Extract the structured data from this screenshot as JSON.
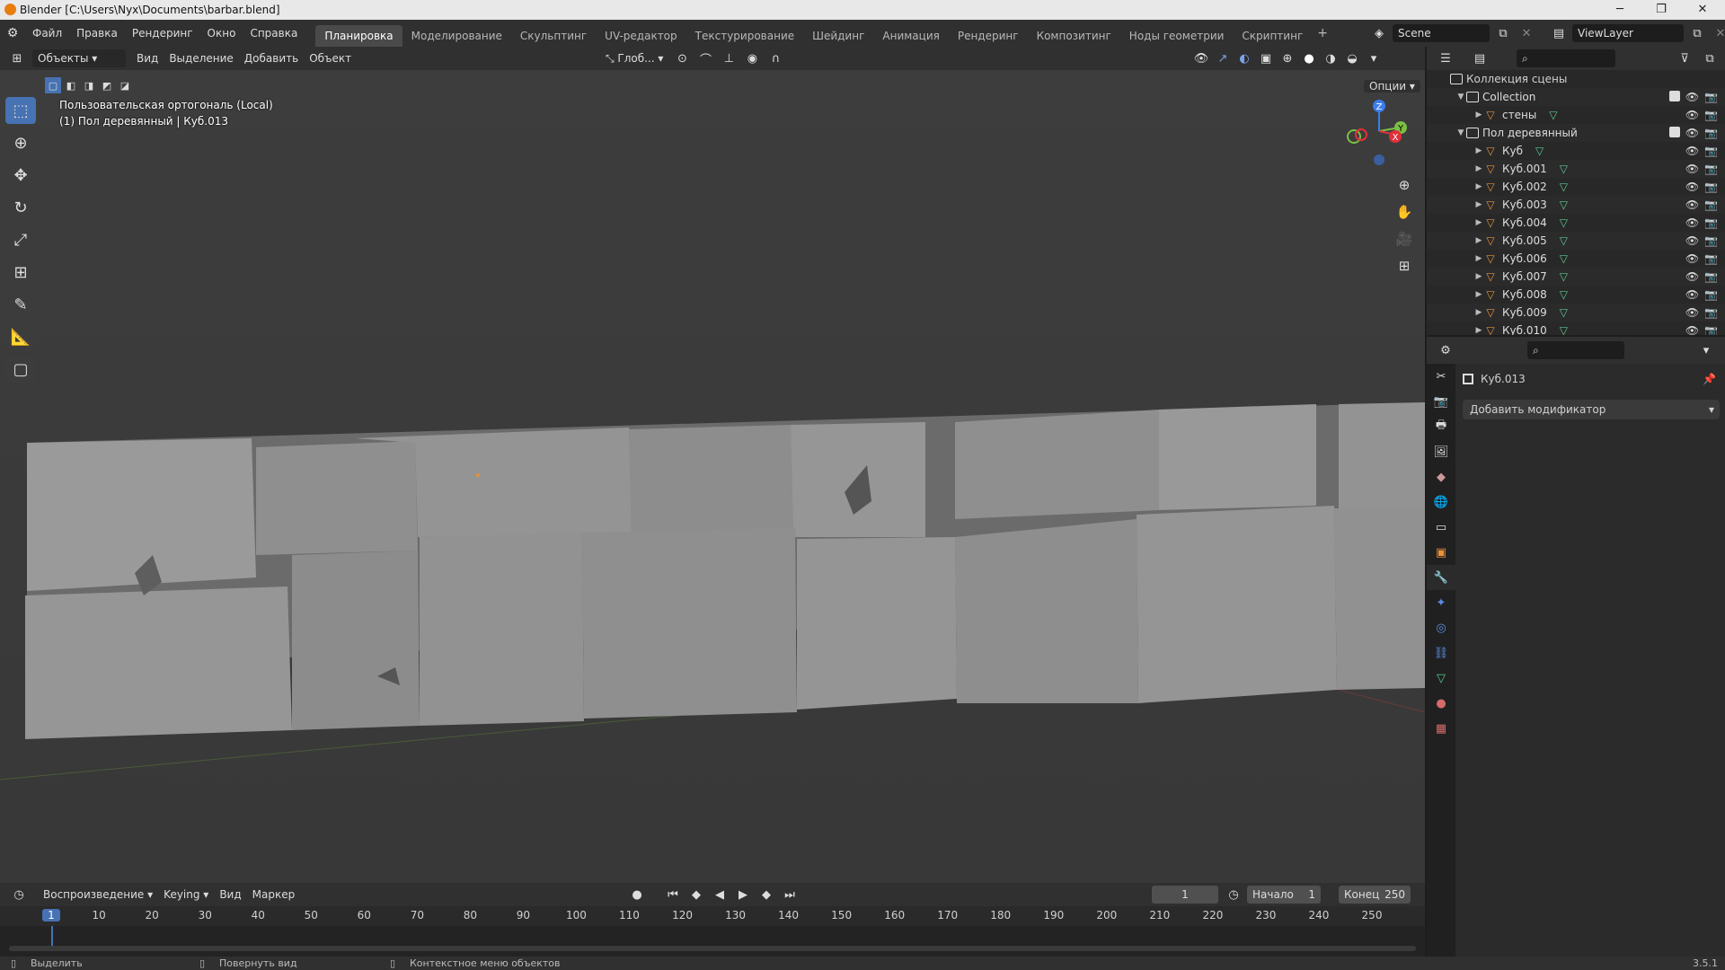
{
  "window": {
    "title": "Blender [C:\\Users\\Nyx\\Documents\\barbar.blend]",
    "minimize": "─",
    "maximize": "❐",
    "close": "✕"
  },
  "menu": [
    "Файл",
    "Правка",
    "Рендеринг",
    "Окно",
    "Справка"
  ],
  "workspaces": {
    "tabs": [
      "Планировка",
      "Моделирование",
      "Скульптинг",
      "UV-редактор",
      "Текстурирование",
      "Шейдинг",
      "Анимация",
      "Рендеринг",
      "Композитинг",
      "Ноды геометрии",
      "Скриптинг"
    ],
    "active_index": 0,
    "add": "+"
  },
  "scene": {
    "name": "Scene",
    "view_layer": "ViewLayer"
  },
  "viewport_header": {
    "mode": "Объекты",
    "menus": [
      "Вид",
      "Выделение",
      "Добавить",
      "Объект"
    ],
    "transform_orientation": "Глоб...",
    "options": "Опции"
  },
  "viewport": {
    "info_line1": "Пользовательская ортогональ (Local)",
    "info_line2": "(1) Пол деревянный | Куб.013",
    "gizmo": {
      "z": "Z",
      "y": "Y",
      "x": "X"
    }
  },
  "outliner": {
    "root": "Коллекция сцены",
    "rows": [
      {
        "label": "Collection",
        "type": "collection",
        "depth": 1,
        "expanded": true
      },
      {
        "label": "стены",
        "type": "mesh",
        "depth": 2,
        "expanded": false
      },
      {
        "label": "Пол деревянный",
        "type": "collection",
        "depth": 1,
        "expanded": true
      },
      {
        "label": "Куб",
        "type": "mesh",
        "depth": 2
      },
      {
        "label": "Куб.001",
        "type": "mesh",
        "depth": 2
      },
      {
        "label": "Куб.002",
        "type": "mesh",
        "depth": 2
      },
      {
        "label": "Куб.003",
        "type": "mesh",
        "depth": 2
      },
      {
        "label": "Куб.004",
        "type": "mesh",
        "depth": 2
      },
      {
        "label": "Куб.005",
        "type": "mesh",
        "depth": 2
      },
      {
        "label": "Куб.006",
        "type": "mesh",
        "depth": 2
      },
      {
        "label": "Куб.007",
        "type": "mesh",
        "depth": 2
      },
      {
        "label": "Куб.008",
        "type": "mesh",
        "depth": 2
      },
      {
        "label": "Куб.009",
        "type": "mesh",
        "depth": 2
      },
      {
        "label": "Куб.010",
        "type": "mesh",
        "depth": 2
      }
    ]
  },
  "properties": {
    "object_name": "Куб.013",
    "add_modifier": "Добавить модификатор"
  },
  "timeline": {
    "menus": [
      "Воспроизведение",
      "Keying",
      "Вид",
      "Маркер"
    ],
    "current_frame": "1",
    "start_label": "Начало",
    "start_value": "1",
    "end_label": "Конец",
    "end_value": "250",
    "ticks": [
      "1",
      "10",
      "20",
      "30",
      "40",
      "50",
      "60",
      "70",
      "80",
      "90",
      "100",
      "110",
      "120",
      "130",
      "140",
      "150",
      "160",
      "170",
      "180",
      "190",
      "200",
      "210",
      "220",
      "230",
      "240",
      "250"
    ]
  },
  "status": {
    "select": "Выделить",
    "rotate": "Повернуть вид",
    "context": "Контекстное меню объектов",
    "version": "3.5.1"
  },
  "colors": {
    "accent": "#4772b3",
    "mesh_icon": "#e8913a",
    "data_icon": "#5ec792",
    "current_frame": "#4772b3"
  }
}
